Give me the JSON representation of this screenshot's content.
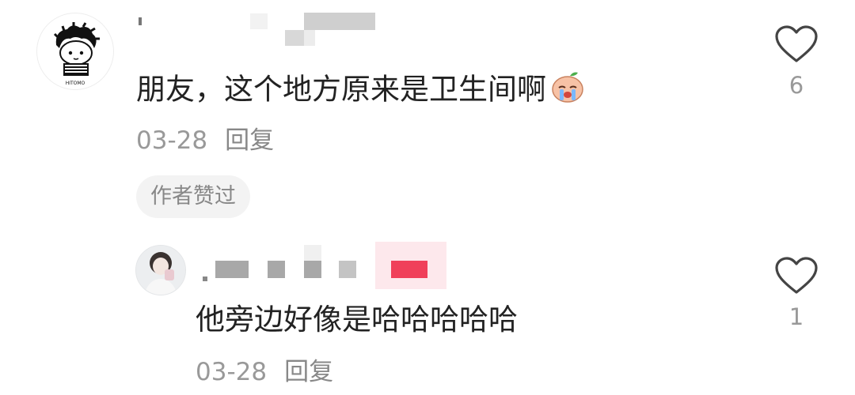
{
  "comments": [
    {
      "text": "朋友，这个地方原来是卫生间啊",
      "date": "03-28",
      "reply_label": "回复",
      "badge": "作者赞过",
      "like_count": "6",
      "avatar_caption": "HITOMO"
    },
    {
      "text": "他旁边好像是哈哈哈哈哈",
      "date": "03-28",
      "reply_label": "回复",
      "like_count": "1"
    }
  ],
  "icons": {
    "like": "heart-outline-icon",
    "emoji": "crying-peach-emoji-icon"
  },
  "colors": {
    "text": "#222222",
    "meta": "#999999",
    "badge_bg": "#f3f3f3",
    "username_tag": "#f0405a"
  }
}
